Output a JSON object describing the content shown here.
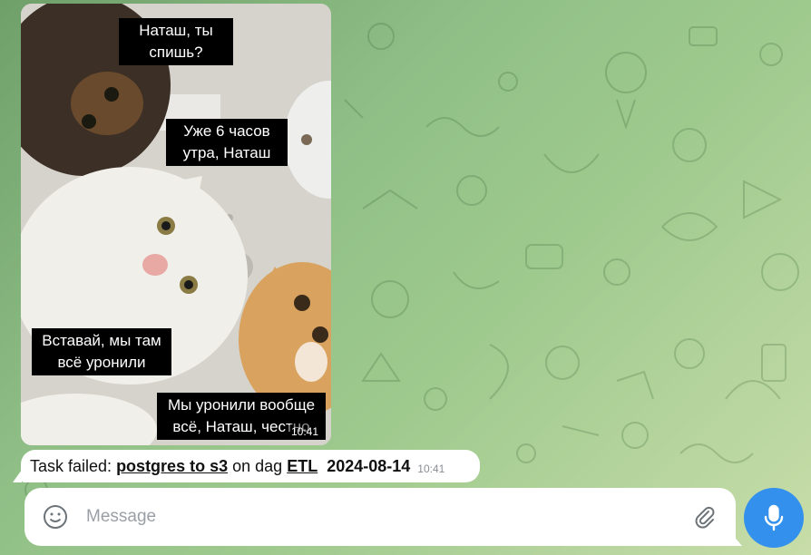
{
  "photo_message": {
    "captions": [
      "Наташ, ты\nспишь?",
      "Уже 6 часов\nутра, Наташ",
      "Вставай, мы там\nвсё уронили",
      "Мы уронили вообще\nвсё, Наташ, честно"
    ],
    "time": "10:41"
  },
  "text_message": {
    "prefix": "Task failed:",
    "task_link": "postgres to s3",
    "middle": "on dag",
    "dag_link": "ETL",
    "date": "2024-08-14",
    "time": "10:41"
  },
  "composer": {
    "placeholder": "Message"
  },
  "icons": {
    "emoji": "emoji-smile-icon",
    "attach": "paperclip-icon",
    "mic": "microphone-icon"
  },
  "colors": {
    "accent": "#3390ec",
    "bubble": "#ffffff"
  }
}
